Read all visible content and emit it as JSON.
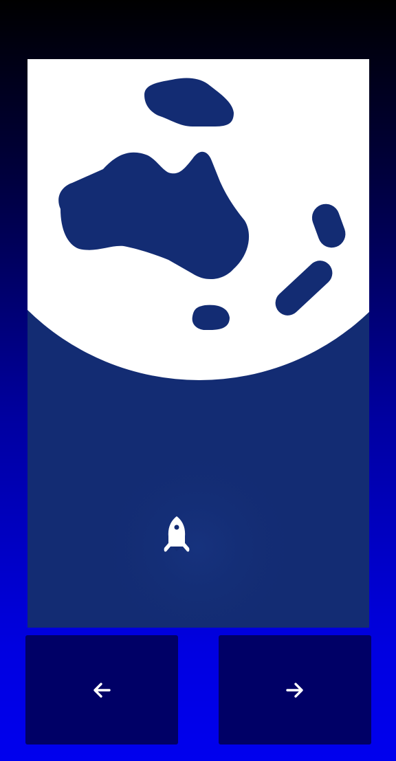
{
  "game": {
    "colors": {
      "background_top": "#000000",
      "background_bottom": "#0000ee",
      "panel": "#132c73",
      "planet": "#ffffff",
      "continents": "#132c73",
      "buttons": "#000066",
      "icons": "#ffffff"
    },
    "icons": {
      "player": "rocket-icon",
      "planet": "globe-planet",
      "move_left": "arrow-left-icon",
      "move_right": "arrow-right-icon"
    }
  }
}
